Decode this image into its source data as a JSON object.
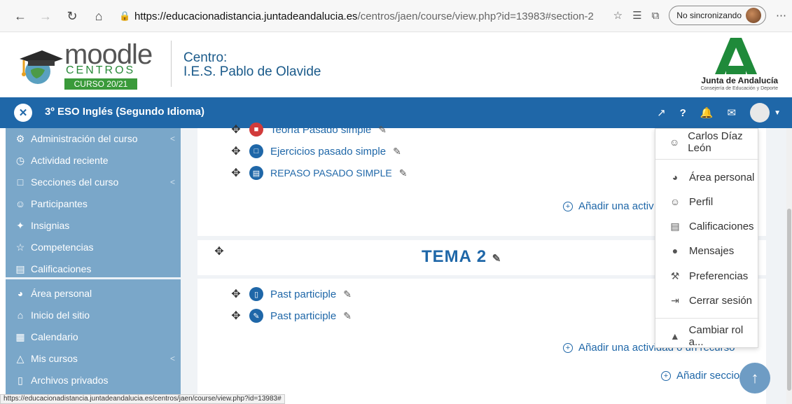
{
  "browser": {
    "url_host": "https://educacionadistancia.juntadeandalucia.es",
    "url_path": "/centros/jaen/course/view.php?id=13983#section-2",
    "sync_label": "No sincronizando",
    "status_url": "https://educacionadistancia.juntadeandalucia.es/centros/jaen/course/view.php?id=13983#"
  },
  "header": {
    "logo_word": "moodle",
    "logo_sub": "CENTROS",
    "logo_badge": "CURSO 20/21",
    "centro_label": "Centro:",
    "centro_name": "I.E.S. Pablo de Olavide",
    "junta_title": "Junta de Andalucía",
    "junta_sub": "Consejería de Educación y Deporte"
  },
  "navbar": {
    "course_title": "3º ESO Inglés (Segundo Idioma)"
  },
  "drawer": {
    "items": [
      {
        "label": "Administración del curso",
        "icon": "gears-icon"
      },
      {
        "label": "Actividad reciente",
        "icon": "clock-icon"
      },
      {
        "label": "Secciones del curso",
        "icon": "folder-icon"
      },
      {
        "label": "Participantes",
        "icon": "users-icon"
      },
      {
        "label": "Insignias",
        "icon": "badge-icon"
      },
      {
        "label": "Competencias",
        "icon": "star-icon"
      },
      {
        "label": "Calificaciones",
        "icon": "table-icon"
      },
      {
        "label": "Área personal",
        "icon": "dashboard-icon"
      },
      {
        "label": "Inicio del sitio",
        "icon": "home-icon"
      },
      {
        "label": "Calendario",
        "icon": "calendar-icon"
      },
      {
        "label": "Mis cursos",
        "icon": "graduation-cap-icon"
      },
      {
        "label": "Archivos privados",
        "icon": "file-icon"
      }
    ]
  },
  "main": {
    "section1_activities": [
      {
        "label": "Teoría Pasado simple",
        "icon": "pdf-icon"
      },
      {
        "label": "Ejercicios pasado simple",
        "icon": "folder-icon"
      },
      {
        "label": "REPASO PASADO SIMPLE",
        "icon": "page-icon"
      }
    ],
    "add_activity_short": "Añadir una activ",
    "section2_title": "TEMA 2",
    "section2_activities": [
      {
        "label": "Past participle",
        "icon": "file-icon"
      },
      {
        "label": "Past participle",
        "icon": "assignment-icon"
      }
    ],
    "add_activity": "Añadir una actividad o un recurso",
    "add_section": "Añadir seccion",
    "add_section_suffix": "es"
  },
  "user_menu": {
    "user_name": "Carlos Díaz León",
    "items": [
      {
        "label": "Área personal",
        "icon": "dashboard-icon"
      },
      {
        "label": "Perfil",
        "icon": "user-icon"
      },
      {
        "label": "Calificaciones",
        "icon": "table-icon"
      },
      {
        "label": "Mensajes",
        "icon": "chat-icon"
      },
      {
        "label": "Preferencias",
        "icon": "wrench-icon"
      },
      {
        "label": "Cerrar sesión",
        "icon": "logout-icon"
      }
    ],
    "switch_role": "Cambiar rol a..."
  },
  "colors": {
    "navbar": "#1f67a8",
    "drawer": "#7aa7c9",
    "accent": "#1f67a8",
    "brand_green": "#3a9a3a"
  }
}
